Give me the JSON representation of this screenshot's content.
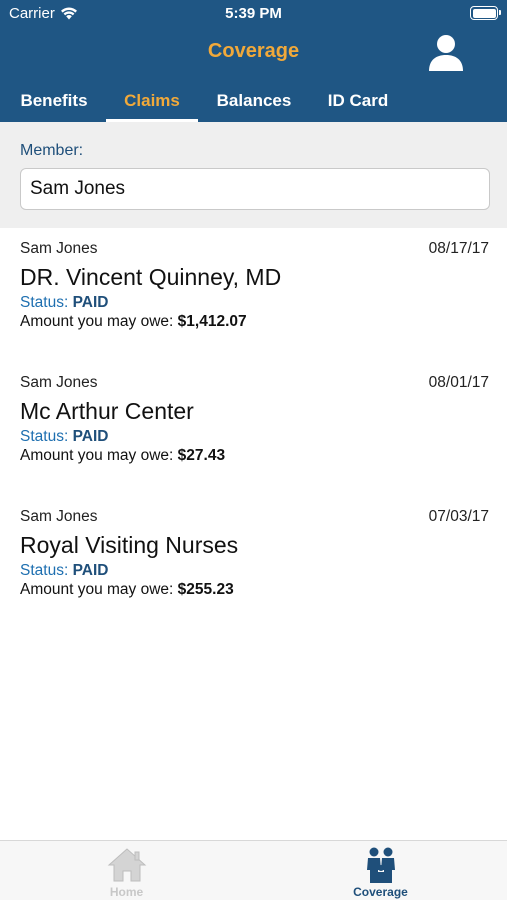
{
  "status_bar": {
    "carrier": "Carrier",
    "time": "5:39 PM"
  },
  "nav": {
    "title": "Coverage",
    "profile_icon": "person-icon"
  },
  "tabs": [
    {
      "label": "Benefits",
      "active": false
    },
    {
      "label": "Claims",
      "active": true
    },
    {
      "label": "Balances",
      "active": false
    },
    {
      "label": "ID Card",
      "active": false
    }
  ],
  "member": {
    "label": "Member:",
    "value": "Sam Jones"
  },
  "claims": [
    {
      "member": "Sam Jones",
      "date": "08/17/17",
      "provider": "DR. Vincent Quinney, MD",
      "status_label": "Status:",
      "status": "PAID",
      "amount_label": "Amount you may owe:",
      "amount": "$1,412.07"
    },
    {
      "member": "Sam Jones",
      "date": "08/01/17",
      "provider": "Mc Arthur Center",
      "status_label": "Status:",
      "status": "PAID",
      "amount_label": "Amount you may owe:",
      "amount": "$27.43"
    },
    {
      "member": "Sam Jones",
      "date": "07/03/17",
      "provider": "Royal Visiting Nurses",
      "status_label": "Status:",
      "status": "PAID",
      "amount_label": "Amount you may owe:",
      "amount": "$255.23"
    }
  ],
  "tabbar": [
    {
      "label": "Home",
      "icon": "home-icon",
      "active": false
    },
    {
      "label": "Coverage",
      "icon": "family-icon",
      "active": true
    }
  ],
  "colors": {
    "header": "#1f5684",
    "accent": "#f1a93a",
    "status_link": "#1e6fb0",
    "active_tabbar": "#1f4f7a",
    "inactive_tabbar": "#c8c8c8"
  }
}
